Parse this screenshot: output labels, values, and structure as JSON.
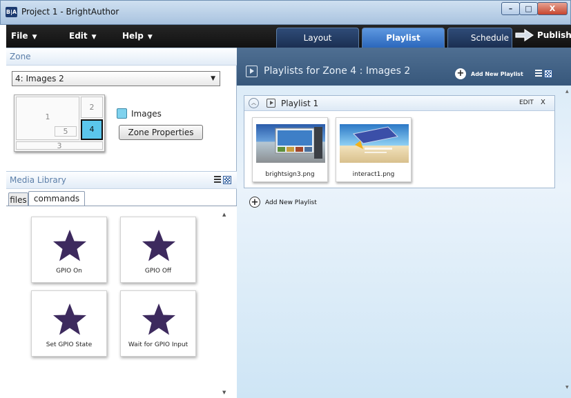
{
  "window": {
    "app_icon_text": "B|A",
    "title": "Project 1 - BrightAuthor",
    "minimize": "–",
    "maximize": "□",
    "close": "X"
  },
  "menu": {
    "items": [
      {
        "label": "File"
      },
      {
        "label": "Edit"
      },
      {
        "label": "Help"
      }
    ],
    "caret": "▼"
  },
  "tabs": [
    {
      "label": "Layout",
      "active": false
    },
    {
      "label": "Playlist",
      "active": true
    },
    {
      "label": "Schedule",
      "active": false
    }
  ],
  "publish_label": "Publish",
  "zone": {
    "header": "Zone",
    "selected": "4: Images 2",
    "select_arrow": "▼",
    "map_cells": [
      "1",
      "2",
      "5",
      "4",
      "3"
    ],
    "swatch_label": "Images",
    "properties_button": "Zone Properties"
  },
  "media_library": {
    "header": "Media Library",
    "tabs": [
      "files",
      "commands"
    ],
    "commands": [
      {
        "label": "GPIO On"
      },
      {
        "label": "GPIO Off"
      },
      {
        "label": "Set GPIO State"
      },
      {
        "label": "Wait for GPIO Input"
      }
    ]
  },
  "playlists": {
    "header_title": "Playlists for Zone 4 : Images 2",
    "add_new_label": "Add New Playlist",
    "add_symbol": "+",
    "items": [
      {
        "name": "Playlist 1",
        "edit_label": "EDIT",
        "close_label": "X",
        "collapse_symbol": "︿",
        "files": [
          {
            "name": "brightsign3.png"
          },
          {
            "name": "interact1.png"
          }
        ]
      }
    ],
    "add_below_label": "Add New Playlist"
  },
  "colors": {
    "active_tab": "#3b7bd0",
    "zone_selected": "#5bc6ec",
    "star": "#3d2a5e"
  }
}
